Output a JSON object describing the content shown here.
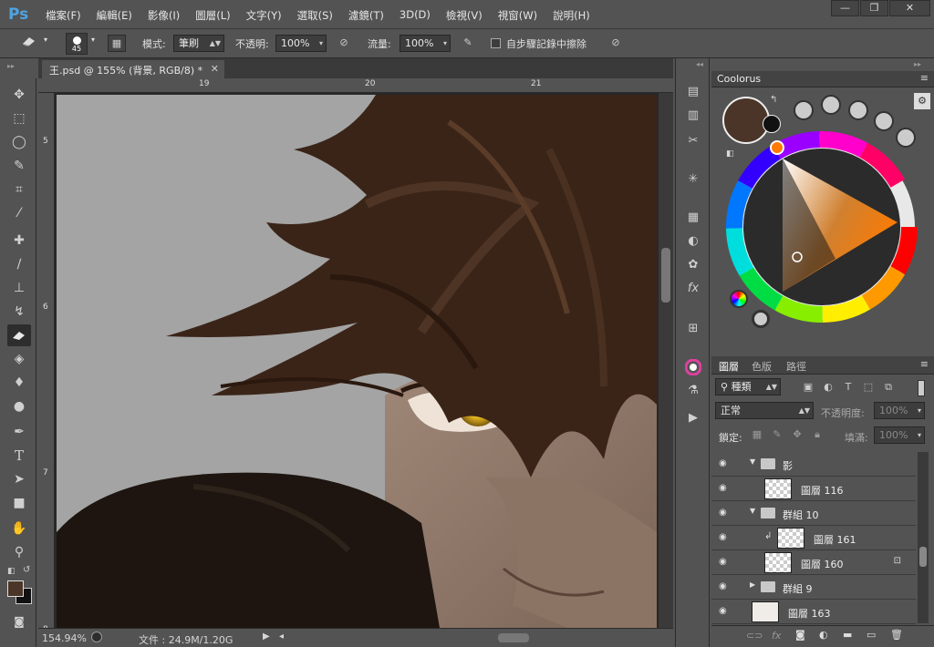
{
  "app": {
    "logo": "Ps"
  },
  "menu": [
    "檔案(F)",
    "編輯(E)",
    "影像(I)",
    "圖層(L)",
    "文字(Y)",
    "選取(S)",
    "濾鏡(T)",
    "3D(D)",
    "檢視(V)",
    "視窗(W)",
    "說明(H)"
  ],
  "window_controls": {
    "minimize": "—",
    "restore": "❐",
    "close": "✕"
  },
  "options": {
    "brush_size": "45",
    "mode_label": "模式:",
    "mode_value": "筆刷",
    "opacity_label": "不透明:",
    "opacity_value": "100%",
    "flow_label": "流量:",
    "flow_value": "100%",
    "erase_to_history": "自步驟記錄中擦除"
  },
  "document": {
    "tab_title": "王.psd @ 155% (背景, RGB/8) *",
    "ruler_top": [
      "19",
      "20",
      "21"
    ],
    "ruler_left": [
      "5",
      "6",
      "7",
      "8"
    ],
    "zoom": "154.94%",
    "file_info": "文件 : 24.9M/1.20G"
  },
  "coolorus": {
    "title": "Coolorus",
    "foreground_color": "#4a3528",
    "background_color": "#111111"
  },
  "layers_panel": {
    "tabs": [
      "圖層",
      "色版",
      "路徑"
    ],
    "filter_label": "種類",
    "blend_mode": "正常",
    "opacity_label": "不透明度:",
    "opacity_value": "100%",
    "lock_label": "鎖定:",
    "fill_label": "填滿:",
    "fill_value": "100%",
    "layers": [
      {
        "name": "影",
        "type": "group",
        "expanded": true,
        "indent": 1
      },
      {
        "name": "圖層 116",
        "type": "layer",
        "indent": 2,
        "thumb": "sketch"
      },
      {
        "name": "群組 10",
        "type": "group",
        "expanded": true,
        "indent": 1
      },
      {
        "name": "圖層 161",
        "type": "layer",
        "indent": 3,
        "clipped": true
      },
      {
        "name": "圖層 160",
        "type": "layer",
        "indent": 2,
        "locked": true
      },
      {
        "name": "群組 9",
        "type": "group",
        "expanded": false,
        "indent": 1
      },
      {
        "name": "圖層 163",
        "type": "layer",
        "indent": 1,
        "thumb": "art"
      }
    ]
  }
}
